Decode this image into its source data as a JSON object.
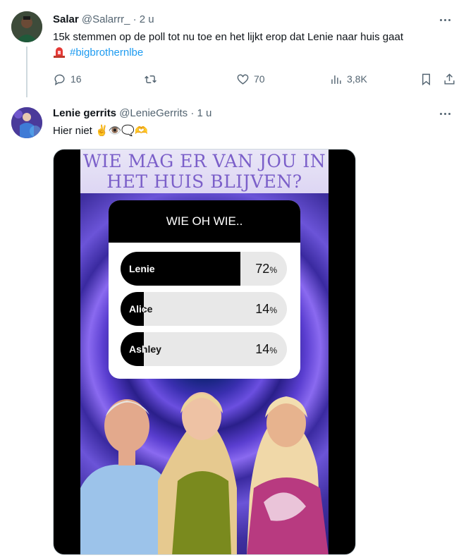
{
  "tweet1": {
    "name": "Salar",
    "handle": "@Salarrr_",
    "dot": "·",
    "time": "2 u",
    "text": "15k stemmen op de poll tot nu toe en het lijkt erop dat Lenie naar huis gaat",
    "emoji_icon": "police-light-icon",
    "hashtag": "#bigbrothernlbe",
    "replies": "16",
    "retweets": "",
    "likes": "70",
    "views": "3,8K"
  },
  "tweet2": {
    "name": "Lenie gerrits",
    "handle": "@LenieGerrits",
    "dot": "·",
    "time": "1 u",
    "text": "Hier niet ✌️👁️🗨️🫶",
    "media": {
      "title_line1": "WIE MAG ER VAN JOU IN",
      "title_line2": "HET HUIS BLIJVEN?",
      "poll_title": "WIE OH WIE..",
      "options": [
        {
          "label": "Lenie",
          "percent": "72",
          "sign": "%",
          "fill_fraction": 0.72
        },
        {
          "label": "Alice",
          "percent": "14",
          "sign": "%",
          "fill_fraction": 0.14
        },
        {
          "label": "Ashley",
          "percent": "14",
          "sign": "%",
          "fill_fraction": 0.14
        }
      ]
    }
  },
  "colors": {
    "link": "#1d9bf0",
    "secondary_text": "#536471",
    "title_purple": "#7b5fc9"
  }
}
